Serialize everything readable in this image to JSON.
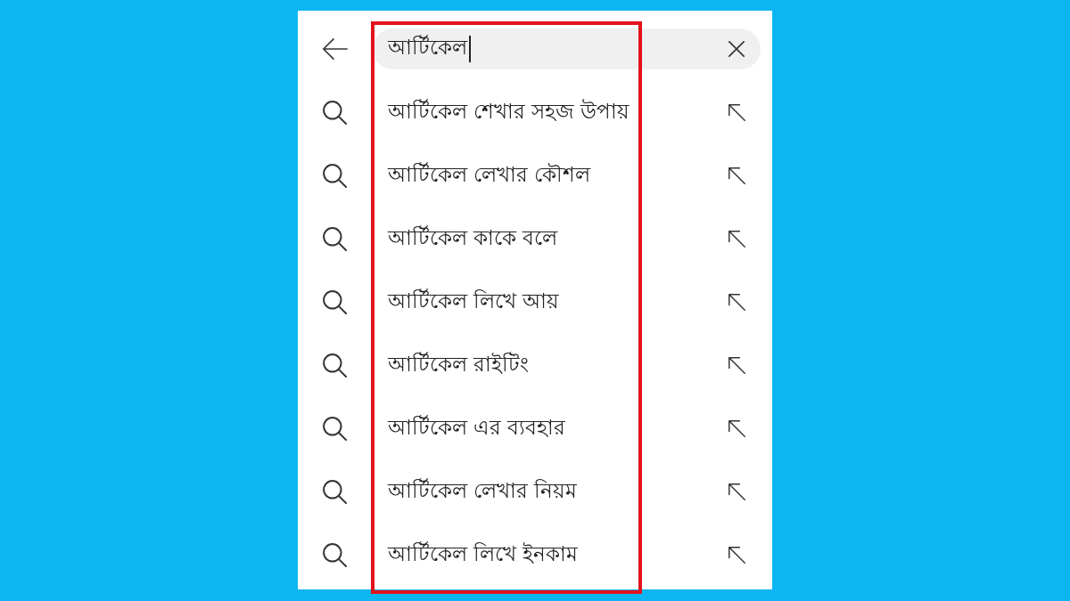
{
  "search": {
    "value": "আর্টিকেল",
    "focused": true
  },
  "suggestions": [
    {
      "text": "আর্টিকেল শেখার সহজ উপায়"
    },
    {
      "text": "আর্টিকেল লেখার কৌশল"
    },
    {
      "text": "আর্টিকেল কাকে বলে"
    },
    {
      "text": "আর্টিকেল লিখে আয়"
    },
    {
      "text": "আর্টিকেল রাইটিং"
    },
    {
      "text": "আর্টিকেল এর ব্যবহার"
    },
    {
      "text": "আর্টিকেল লেখার নিয়ম"
    },
    {
      "text": "আর্টিকেল লিখে ইনকাম"
    }
  ]
}
